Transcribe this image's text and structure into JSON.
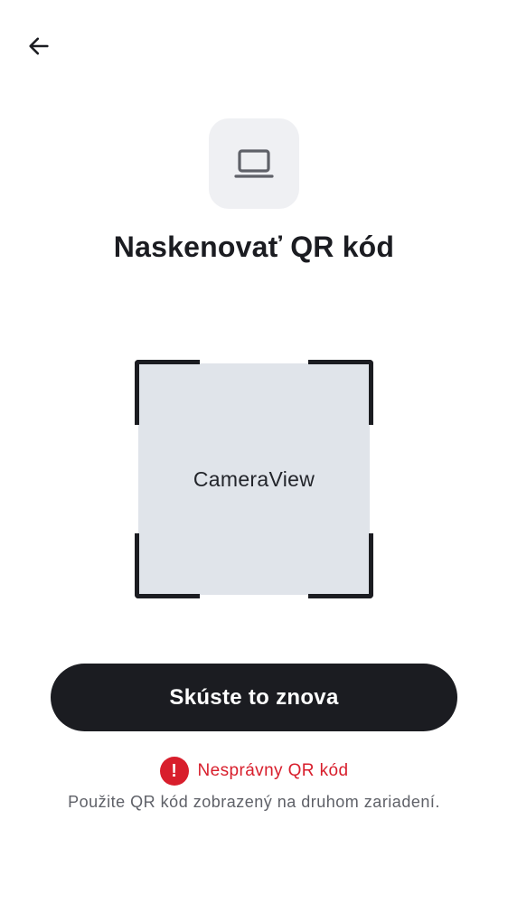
{
  "header": {
    "back_icon": "arrow-left-icon"
  },
  "hero": {
    "icon": "laptop-icon",
    "tile_color": "#eff0f3"
  },
  "title": "Naskenovať QR kód",
  "scanner": {
    "camera_label": "CameraView"
  },
  "actions": {
    "retry_label": "Skúste to znova"
  },
  "error": {
    "icon": "exclamation-icon",
    "icon_glyph": "!",
    "message": "Nesprávny QR kód",
    "hint": "Použite QR kód zobrazený na druhom zariadení.",
    "color": "#d81e2c"
  },
  "colors": {
    "primary": "#1b1c21",
    "camera_bg": "#e0e4ea"
  }
}
